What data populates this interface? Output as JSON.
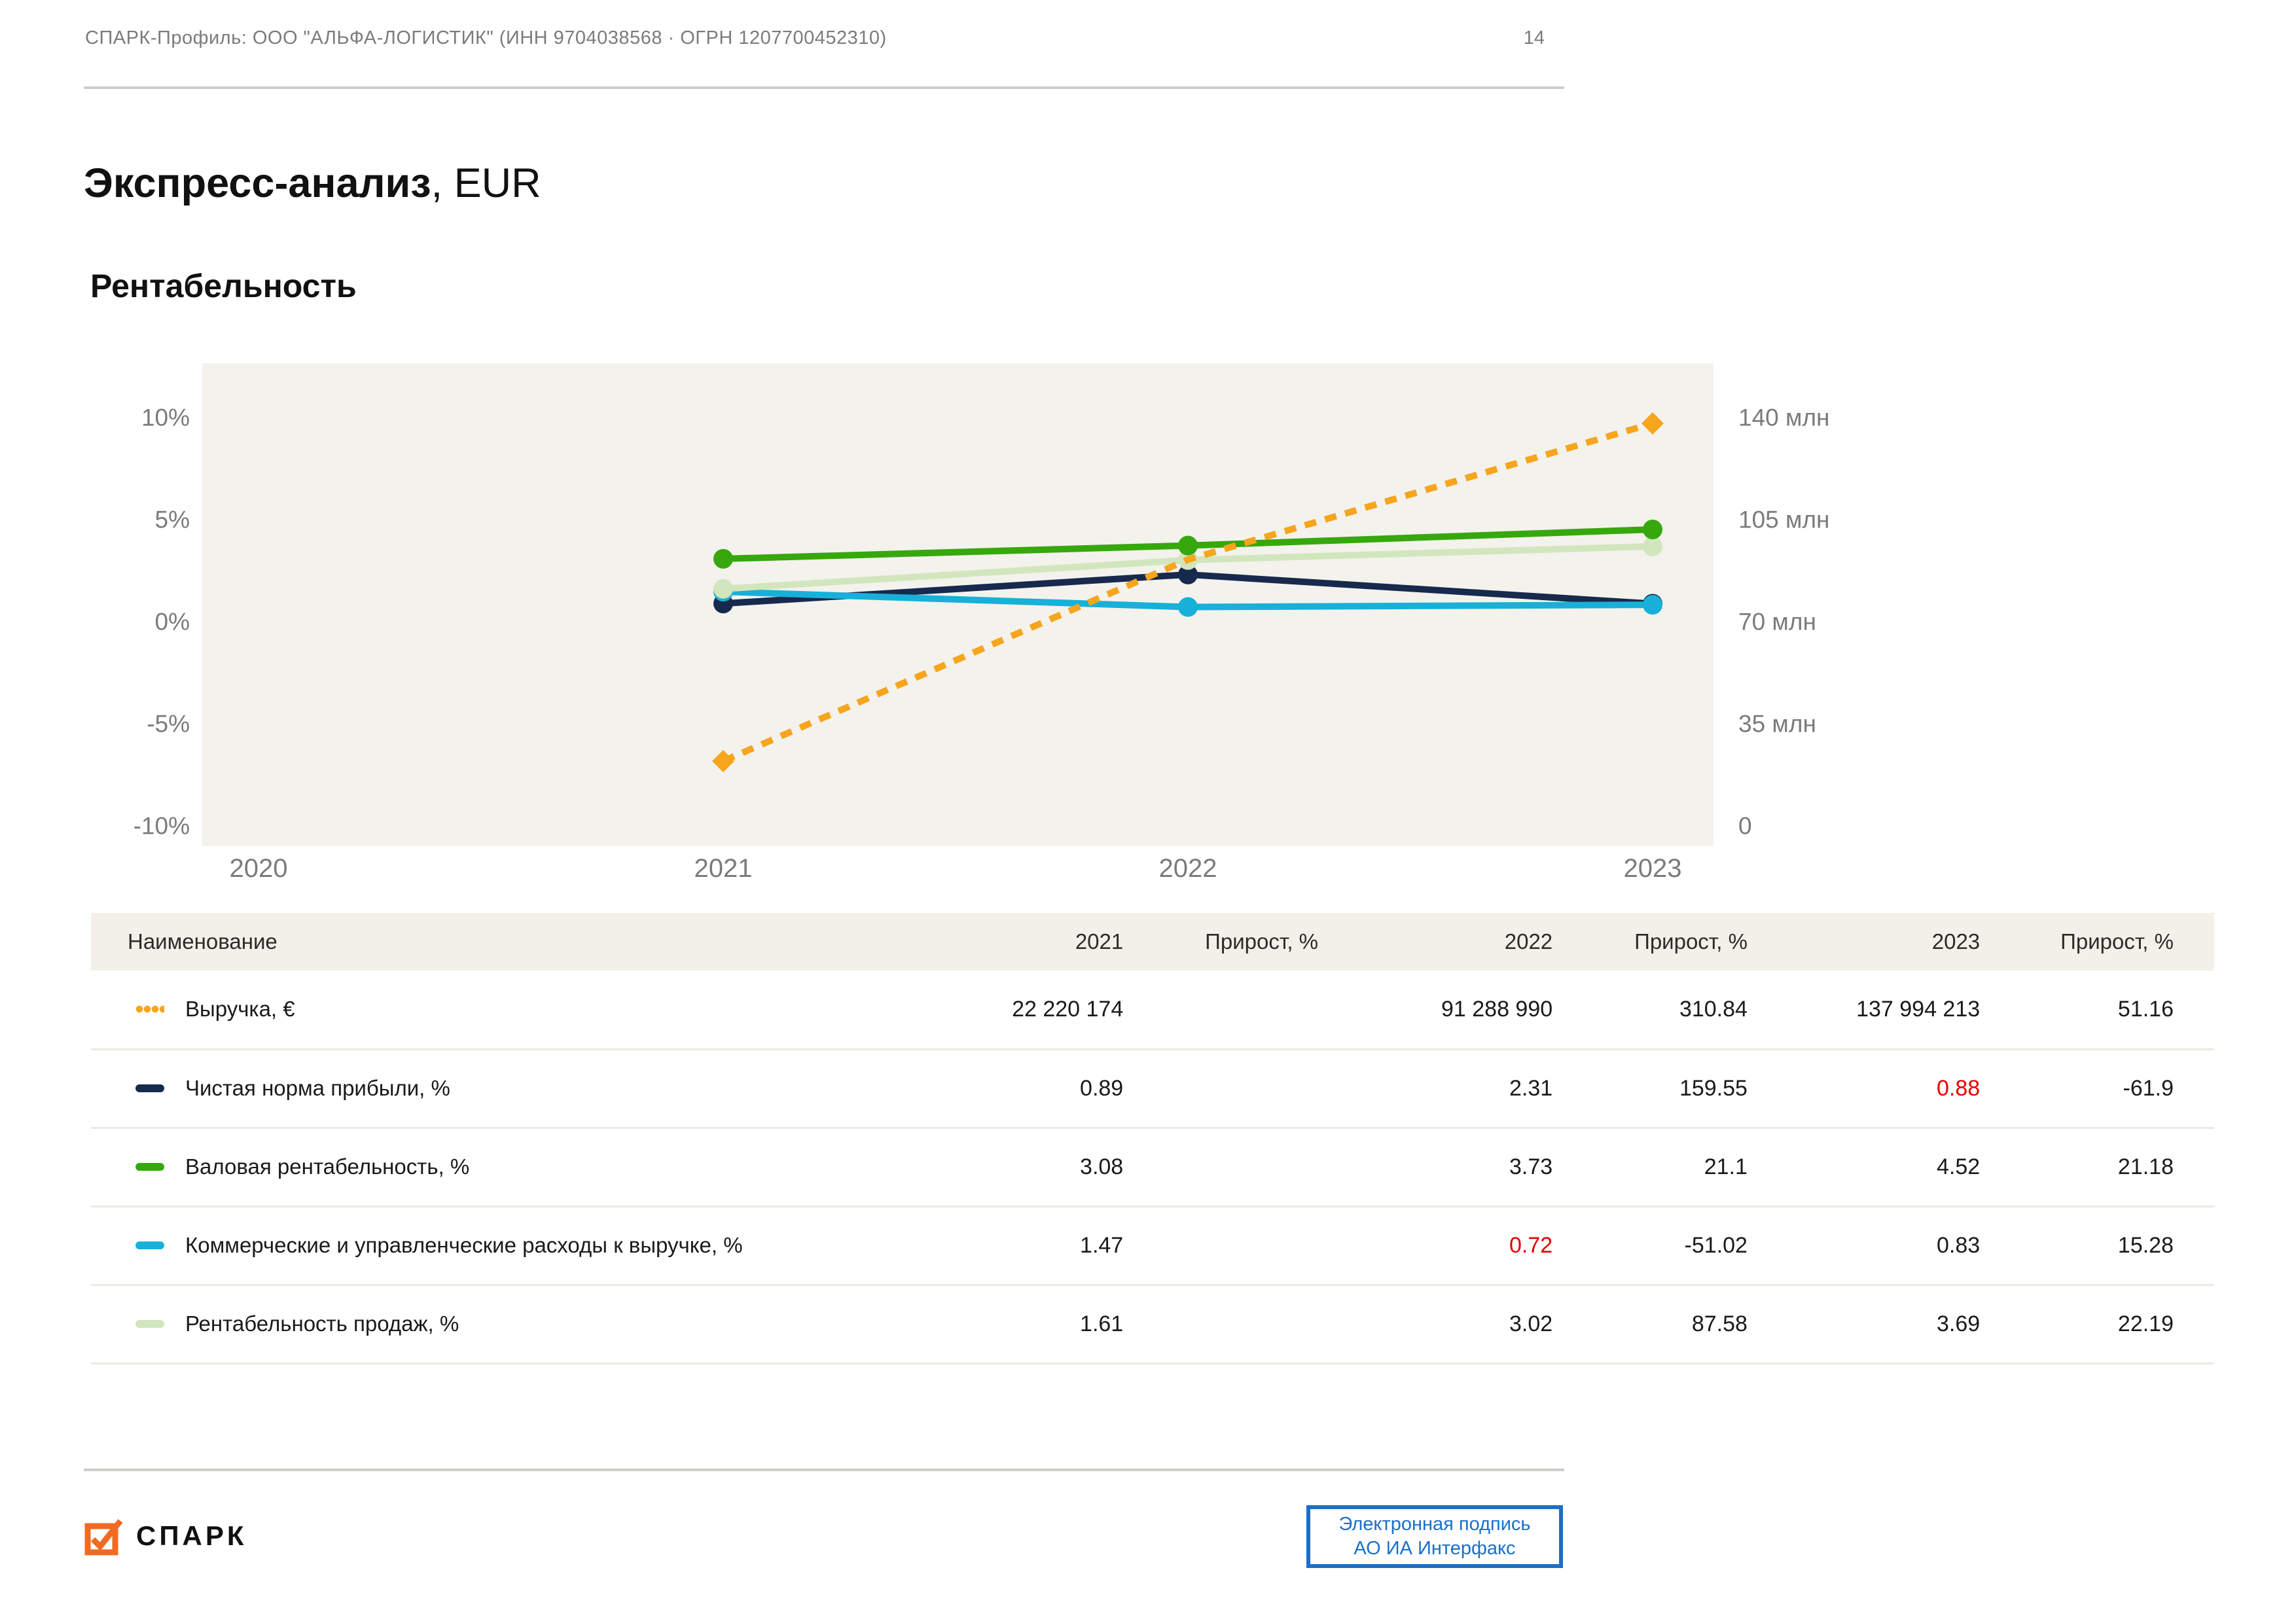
{
  "page": {
    "header": "СПАРК-Профиль: ООО \"АЛЬФА-ЛОГИСТИК\" (ИНН 9704038568 · ОГРН 1207700452310)",
    "page_number": "14"
  },
  "title": {
    "main": "Экспресс-анализ",
    "suffix": ", EUR"
  },
  "section_title": "Рентабельность",
  "colors": {
    "revenue_orange": "#F6A51C",
    "net_margin_navy": "#17294D",
    "gross_margin_green": "#36A80D",
    "expenses_cyan": "#18B0D8",
    "ros_pale_green": "#D2E6BD",
    "negative_red": "#E60000",
    "chart_background": "#F4F2ED",
    "table_header_background": "#F2F0E9",
    "signature_blue": "#1A6FC9",
    "logo_orange": "#F26A21"
  },
  "chart_data": {
    "type": "line",
    "title": "Рентабельность",
    "x": [
      2020,
      2021,
      2022,
      2023
    ],
    "left_axis": {
      "unit": "%",
      "min": -10,
      "max": 10,
      "ticks": [
        "10%",
        "5%",
        "0%",
        "-5%",
        "-10%"
      ],
      "tick_values": [
        10,
        5,
        0,
        -5,
        -10
      ]
    },
    "right_axis": {
      "unit": "млн",
      "min": 0,
      "max": 140000000,
      "ticks": [
        "140 млн",
        "105 млн",
        "70 млн",
        "35 млн",
        "0"
      ],
      "tick_values": [
        140000000,
        105000000,
        70000000,
        35000000,
        0
      ]
    },
    "grid": false,
    "legend_position": "table-swatches",
    "series": [
      {
        "name": "Выручка, €",
        "axis": "right",
        "style": "dotted",
        "marker": "diamond",
        "color": "#F6A51C",
        "x": [
          2021,
          2022,
          2023
        ],
        "values": [
          22220174,
          91288990,
          137994213
        ]
      },
      {
        "name": "Чистая норма прибыли, %",
        "axis": "left",
        "style": "solid",
        "marker": "circle",
        "color": "#17294D",
        "x": [
          2021,
          2022,
          2023
        ],
        "values": [
          0.89,
          2.31,
          0.88
        ]
      },
      {
        "name": "Валовая рентабельность, %",
        "axis": "left",
        "style": "solid",
        "marker": "circle",
        "color": "#36A80D",
        "x": [
          2021,
          2022,
          2023
        ],
        "values": [
          3.08,
          3.73,
          4.52
        ]
      },
      {
        "name": "Коммерческие и управленческие расходы к выручке, %",
        "axis": "left",
        "style": "solid",
        "marker": "circle",
        "color": "#18B0D8",
        "x": [
          2021,
          2022,
          2023
        ],
        "values": [
          1.47,
          0.72,
          0.83
        ]
      },
      {
        "name": "Рентабельность продаж, %",
        "axis": "left",
        "style": "solid",
        "marker": "circle",
        "color": "#D2E6BD",
        "x": [
          2021,
          2022,
          2023
        ],
        "values": [
          1.61,
          3.02,
          3.69
        ]
      }
    ],
    "draw_order": [
      1,
      3,
      4,
      2,
      0
    ]
  },
  "table": {
    "headers": [
      "Наименование",
      "2021",
      "Прирост, %",
      "2022",
      "Прирост, %",
      "2023",
      "Прирост, %"
    ],
    "rows": [
      {
        "label": "Выручка, €",
        "series_index": 0,
        "values": [
          "22 220 174",
          "",
          "91 288 990",
          "310.84",
          "137 994 213",
          "51.16"
        ],
        "red": []
      },
      {
        "label": "Чистая норма прибыли, %",
        "series_index": 1,
        "values": [
          "0.89",
          "",
          "2.31",
          "159.55",
          "0.88",
          "-61.9"
        ],
        "red": [
          5
        ]
      },
      {
        "label": "Валовая рентабельность, %",
        "series_index": 2,
        "values": [
          "3.08",
          "",
          "3.73",
          "21.1",
          "4.52",
          "21.18"
        ],
        "red": []
      },
      {
        "label": "Коммерческие и управленческие расходы к выручке, %",
        "series_index": 3,
        "values": [
          "1.47",
          "",
          "0.72",
          "-51.02",
          "0.83",
          "15.28"
        ],
        "red": [
          3
        ]
      },
      {
        "label": "Рентабельность продаж, %",
        "series_index": 4,
        "values": [
          "1.61",
          "",
          "3.02",
          "87.58",
          "3.69",
          "22.19"
        ],
        "red": []
      }
    ]
  },
  "footer": {
    "logo_text": "СПАРК",
    "signature_line1": "Электронная подпись",
    "signature_line2": "АО ИА Интерфакс"
  }
}
